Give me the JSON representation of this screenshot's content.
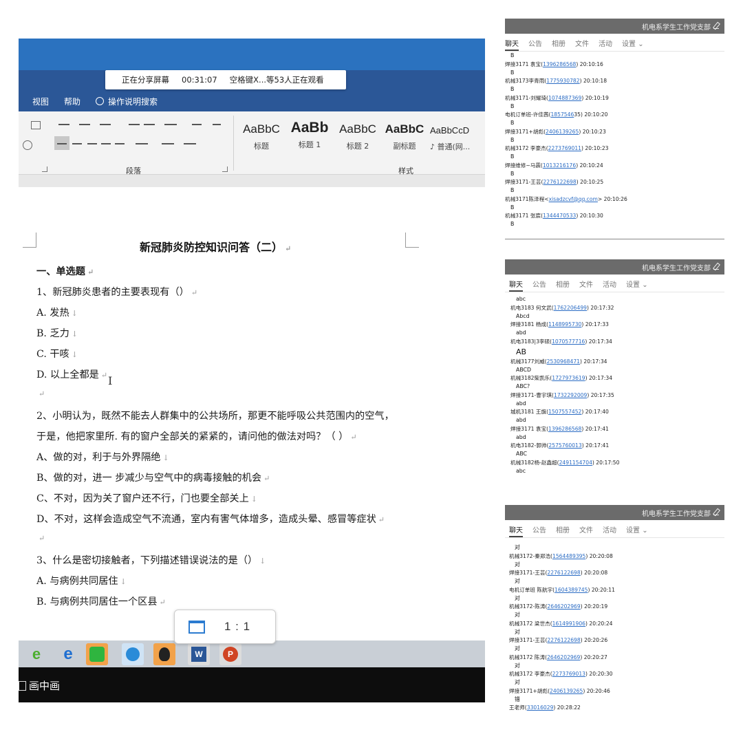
{
  "share": {
    "status": "正在分享屏幕",
    "time": "00:31:07",
    "viewers": "空格键X...等53人正在观看"
  },
  "word": {
    "menus": [
      "视图",
      "帮助",
      "操作说明搜索"
    ],
    "ribbon": {
      "paragraph_label": "段落",
      "styles_label": "样式",
      "styles": [
        {
          "sample": "AaBbC",
          "name": "标题"
        },
        {
          "sample": "AaBb",
          "name": "标题 1"
        },
        {
          "sample": "AaBbC",
          "name": "标题 2"
        },
        {
          "sample": "AaBbC",
          "name": "副标题"
        },
        {
          "sample": "AaBbCcD",
          "name": "♪ 普通(网..."
        }
      ]
    },
    "doc": {
      "title": "新冠肺炎防控知识问答（二）",
      "lines": [
        "一、单选题",
        "1、新冠肺炎患者的主要表现有（）",
        "A. 发热",
        "B. 乏力",
        "C. 干咳",
        "D. 以上全都是",
        "",
        "2、小明认为，既然不能去人群集中的公共场所，那更不能呼吸公共范围内的空气，",
        "于是，他把家里所. 有的窗户全部关的紧紧的，请问他的做法对吗？（    ）",
        "A、做的对，利于与外界隔绝",
        "B、做的对，进一    步减少与空气中的病毒接触的机会",
        "C、不对，因为关了窗户还不行，门也要全部关上",
        "D、不对，这样会造成空气不流通，室内有害气体增多，造成头晕、感冒等症状",
        "",
        "3、什么是密切接触者，下列描述错误说法的是（）",
        "A. 与病例共同居住",
        "B. 与病例共同居住一个区县"
      ]
    },
    "zoom": "1 : 1",
    "pip": "画中画"
  },
  "chats": [
    {
      "title": "机电系学生工作党支部",
      "tabs": [
        "聊天",
        "公告",
        "相册",
        "文件",
        "活动",
        "设置"
      ],
      "messages": [
        {
          "sender": "",
          "qq": "",
          "time": "",
          "body": "B"
        },
        {
          "sender": "焊接3171   袁宝(",
          "qq": "1396286568",
          "time": ") 20:10:16",
          "body": "B"
        },
        {
          "sender": "机械3173李青雨(",
          "qq": "1775930782",
          "time": ") 20:10:18",
          "body": "B"
        },
        {
          "sender": "机械3171-刘耀琦(",
          "qq": "1074887369",
          "time": ") 20:10:19",
          "body": "B"
        },
        {
          "sender": "电机订单班-许佳茜(",
          "qq": "1857546",
          "time": "35) 20:10:20",
          "body": "B"
        },
        {
          "sender": "焊接3171+胡彪(",
          "qq": "2406139265",
          "time": ") 20:10:23",
          "body": "B"
        },
        {
          "sender": "机械3172  李豪杰(",
          "qq": "2273769011",
          "time": ") 20:10:23",
          "body": "B"
        },
        {
          "sender": "焊接维修~马震(",
          "qq": "1013216176",
          "time": ") 20:10:24",
          "body": "B"
        },
        {
          "sender": "焊接3171-王芸(",
          "qq": "2276122698",
          "time": ") 20:10:25",
          "body": "B"
        },
        {
          "sender": "机械3171陈泽程<",
          "qq": "xisadzcvf@qq.com",
          "time": "> 20:10:26",
          "body": "B"
        },
        {
          "sender": "机械3171 张宸(",
          "qq": "1344470533",
          "time": ") 20:10:30",
          "body": "B"
        }
      ]
    },
    {
      "title": "机电系学生工作党支部",
      "tabs": [
        "聊天",
        "公告",
        "相册",
        "文件",
        "活动",
        "设置"
      ],
      "messages": [
        {
          "sender": "",
          "qq": "",
          "time": "",
          "body": "abc"
        },
        {
          "sender": "机电3183 何文武(",
          "qq": "1762206499",
          "time": ") 20:17:32",
          "body": "Abcd"
        },
        {
          "sender": "焊接3181 杨成(",
          "qq": "1148995730",
          "time": ") 20:17:33",
          "body": "abd"
        },
        {
          "sender": "机电3183|3李硕(",
          "qq": "1070577716",
          "time": ") 20:17:34",
          "body": "AB"
        },
        {
          "sender": "机械3177刘威(",
          "qq": "2530968471",
          "time": ") 20:17:34",
          "body": "ABCD"
        },
        {
          "sender": "机械3182柴凯乐(",
          "qq": "1727973619",
          "time": ") 20:17:34",
          "body": "ABC?"
        },
        {
          "sender": "焊接3171-曹宇琪(",
          "qq": "1732292009",
          "time": ") 20:17:35",
          "body": "abd"
        },
        {
          "sender": "城机3181  王旗(",
          "qq": "1507557452",
          "time": ") 20:17:40",
          "body": "abd"
        },
        {
          "sender": "焊接3171    袁宝(",
          "qq": "1396286568",
          "time": ") 20:17:41",
          "body": "abd"
        },
        {
          "sender": "机电3182-郭帅(",
          "qq": "2575760013",
          "time": ") 20:17:41",
          "body": "ABC"
        },
        {
          "sender": "机械3182杨-赵鑫超(",
          "qq": "2491154704",
          "time": ") 20:17:50",
          "body": "abc"
        }
      ]
    },
    {
      "title": "机电系学生工作党支部",
      "tabs": [
        "聊天",
        "公告",
        "相册",
        "文件",
        "活动",
        "设置"
      ],
      "messages": [
        {
          "sender": "",
          "qq": "",
          "time": "",
          "body": "对"
        },
        {
          "sender": "机械3172-秦郑浩(",
          "qq": "1564489395",
          "time": ") 20:20:08",
          "body": "对"
        },
        {
          "sender": "焊接3171-王芸(",
          "qq": "2276122698",
          "time": ") 20:20:08",
          "body": "对"
        },
        {
          "sender": "电机订单班  陈航宇(",
          "qq": "1604389745",
          "time": ") 20:20:11",
          "body": "对"
        },
        {
          "sender": "机械3172-陈涛(",
          "qq": "2646202969",
          "time": ") 20:20:19",
          "body": "对"
        },
        {
          "sender": "机械3172 梁世杰(",
          "qq": "1614991906",
          "time": ") 20:20:24",
          "body": "对"
        },
        {
          "sender": "焊接3171-王芸(",
          "qq": "2276122698",
          "time": ") 20:20:26",
          "body": "对"
        },
        {
          "sender": "机械3172 陈涛(",
          "qq": "2646202969",
          "time": ") 20:20:27",
          "body": "对"
        },
        {
          "sender": "机械3172   李豪杰(",
          "qq": "2273769013",
          "time": ") 20:20:30",
          "body": "对"
        },
        {
          "sender": "焊接3171+胡彪(",
          "qq": "2406139265",
          "time": ") 20:20:46",
          "body": "错"
        },
        {
          "sender": "王老师(",
          "qq": "33016029",
          "time": ") 20:28:22",
          "body": ""
        }
      ]
    }
  ],
  "colors": {
    "word_blue": "#2b72bf",
    "chat_header": "#6b6b6b",
    "link": "#2b6cc4"
  }
}
